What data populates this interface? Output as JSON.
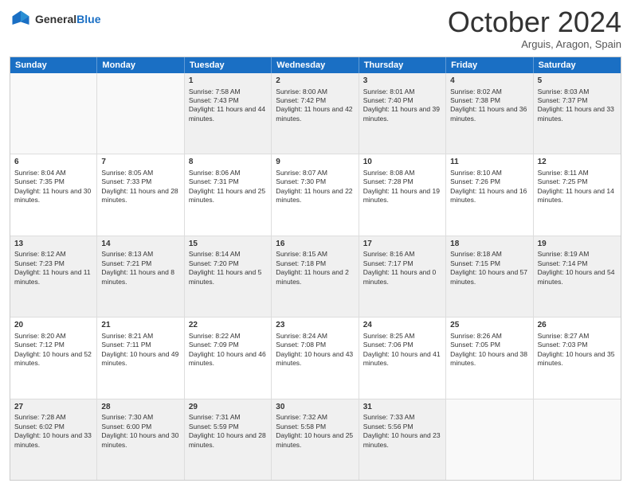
{
  "header": {
    "logo_general": "General",
    "logo_blue": "Blue",
    "month_title": "October 2024",
    "location": "Arguis, Aragon, Spain"
  },
  "days_of_week": [
    "Sunday",
    "Monday",
    "Tuesday",
    "Wednesday",
    "Thursday",
    "Friday",
    "Saturday"
  ],
  "weeks": [
    [
      {
        "day": "",
        "empty": true
      },
      {
        "day": "",
        "empty": true
      },
      {
        "day": "1",
        "sunrise": "Sunrise: 7:58 AM",
        "sunset": "Sunset: 7:43 PM",
        "daylight": "Daylight: 11 hours and 44 minutes."
      },
      {
        "day": "2",
        "sunrise": "Sunrise: 8:00 AM",
        "sunset": "Sunset: 7:42 PM",
        "daylight": "Daylight: 11 hours and 42 minutes."
      },
      {
        "day": "3",
        "sunrise": "Sunrise: 8:01 AM",
        "sunset": "Sunset: 7:40 PM",
        "daylight": "Daylight: 11 hours and 39 minutes."
      },
      {
        "day": "4",
        "sunrise": "Sunrise: 8:02 AM",
        "sunset": "Sunset: 7:38 PM",
        "daylight": "Daylight: 11 hours and 36 minutes."
      },
      {
        "day": "5",
        "sunrise": "Sunrise: 8:03 AM",
        "sunset": "Sunset: 7:37 PM",
        "daylight": "Daylight: 11 hours and 33 minutes."
      }
    ],
    [
      {
        "day": "6",
        "sunrise": "Sunrise: 8:04 AM",
        "sunset": "Sunset: 7:35 PM",
        "daylight": "Daylight: 11 hours and 30 minutes."
      },
      {
        "day": "7",
        "sunrise": "Sunrise: 8:05 AM",
        "sunset": "Sunset: 7:33 PM",
        "daylight": "Daylight: 11 hours and 28 minutes."
      },
      {
        "day": "8",
        "sunrise": "Sunrise: 8:06 AM",
        "sunset": "Sunset: 7:31 PM",
        "daylight": "Daylight: 11 hours and 25 minutes."
      },
      {
        "day": "9",
        "sunrise": "Sunrise: 8:07 AM",
        "sunset": "Sunset: 7:30 PM",
        "daylight": "Daylight: 11 hours and 22 minutes."
      },
      {
        "day": "10",
        "sunrise": "Sunrise: 8:08 AM",
        "sunset": "Sunset: 7:28 PM",
        "daylight": "Daylight: 11 hours and 19 minutes."
      },
      {
        "day": "11",
        "sunrise": "Sunrise: 8:10 AM",
        "sunset": "Sunset: 7:26 PM",
        "daylight": "Daylight: 11 hours and 16 minutes."
      },
      {
        "day": "12",
        "sunrise": "Sunrise: 8:11 AM",
        "sunset": "Sunset: 7:25 PM",
        "daylight": "Daylight: 11 hours and 14 minutes."
      }
    ],
    [
      {
        "day": "13",
        "sunrise": "Sunrise: 8:12 AM",
        "sunset": "Sunset: 7:23 PM",
        "daylight": "Daylight: 11 hours and 11 minutes."
      },
      {
        "day": "14",
        "sunrise": "Sunrise: 8:13 AM",
        "sunset": "Sunset: 7:21 PM",
        "daylight": "Daylight: 11 hours and 8 minutes."
      },
      {
        "day": "15",
        "sunrise": "Sunrise: 8:14 AM",
        "sunset": "Sunset: 7:20 PM",
        "daylight": "Daylight: 11 hours and 5 minutes."
      },
      {
        "day": "16",
        "sunrise": "Sunrise: 8:15 AM",
        "sunset": "Sunset: 7:18 PM",
        "daylight": "Daylight: 11 hours and 2 minutes."
      },
      {
        "day": "17",
        "sunrise": "Sunrise: 8:16 AM",
        "sunset": "Sunset: 7:17 PM",
        "daylight": "Daylight: 11 hours and 0 minutes."
      },
      {
        "day": "18",
        "sunrise": "Sunrise: 8:18 AM",
        "sunset": "Sunset: 7:15 PM",
        "daylight": "Daylight: 10 hours and 57 minutes."
      },
      {
        "day": "19",
        "sunrise": "Sunrise: 8:19 AM",
        "sunset": "Sunset: 7:14 PM",
        "daylight": "Daylight: 10 hours and 54 minutes."
      }
    ],
    [
      {
        "day": "20",
        "sunrise": "Sunrise: 8:20 AM",
        "sunset": "Sunset: 7:12 PM",
        "daylight": "Daylight: 10 hours and 52 minutes."
      },
      {
        "day": "21",
        "sunrise": "Sunrise: 8:21 AM",
        "sunset": "Sunset: 7:11 PM",
        "daylight": "Daylight: 10 hours and 49 minutes."
      },
      {
        "day": "22",
        "sunrise": "Sunrise: 8:22 AM",
        "sunset": "Sunset: 7:09 PM",
        "daylight": "Daylight: 10 hours and 46 minutes."
      },
      {
        "day": "23",
        "sunrise": "Sunrise: 8:24 AM",
        "sunset": "Sunset: 7:08 PM",
        "daylight": "Daylight: 10 hours and 43 minutes."
      },
      {
        "day": "24",
        "sunrise": "Sunrise: 8:25 AM",
        "sunset": "Sunset: 7:06 PM",
        "daylight": "Daylight: 10 hours and 41 minutes."
      },
      {
        "day": "25",
        "sunrise": "Sunrise: 8:26 AM",
        "sunset": "Sunset: 7:05 PM",
        "daylight": "Daylight: 10 hours and 38 minutes."
      },
      {
        "day": "26",
        "sunrise": "Sunrise: 8:27 AM",
        "sunset": "Sunset: 7:03 PM",
        "daylight": "Daylight: 10 hours and 35 minutes."
      }
    ],
    [
      {
        "day": "27",
        "sunrise": "Sunrise: 7:28 AM",
        "sunset": "Sunset: 6:02 PM",
        "daylight": "Daylight: 10 hours and 33 minutes."
      },
      {
        "day": "28",
        "sunrise": "Sunrise: 7:30 AM",
        "sunset": "Sunset: 6:00 PM",
        "daylight": "Daylight: 10 hours and 30 minutes."
      },
      {
        "day": "29",
        "sunrise": "Sunrise: 7:31 AM",
        "sunset": "Sunset: 5:59 PM",
        "daylight": "Daylight: 10 hours and 28 minutes."
      },
      {
        "day": "30",
        "sunrise": "Sunrise: 7:32 AM",
        "sunset": "Sunset: 5:58 PM",
        "daylight": "Daylight: 10 hours and 25 minutes."
      },
      {
        "day": "31",
        "sunrise": "Sunrise: 7:33 AM",
        "sunset": "Sunset: 5:56 PM",
        "daylight": "Daylight: 10 hours and 23 minutes."
      },
      {
        "day": "",
        "empty": true
      },
      {
        "day": "",
        "empty": true
      }
    ]
  ]
}
